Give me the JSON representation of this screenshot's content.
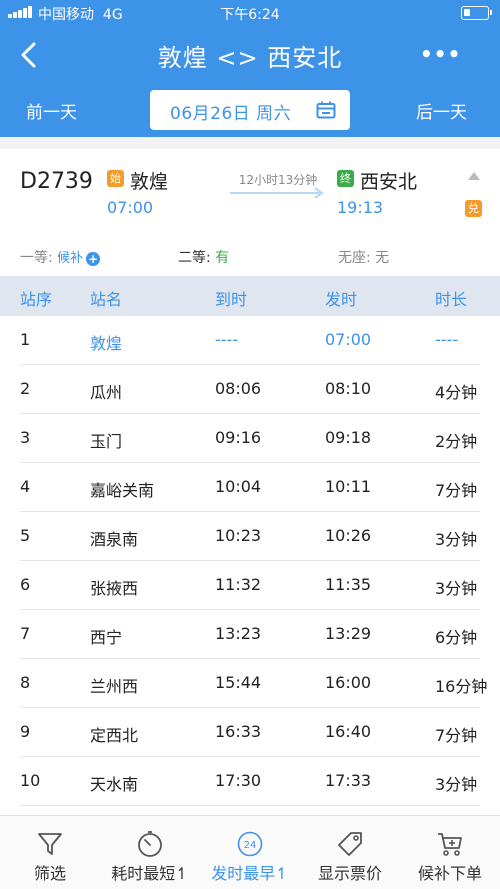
{
  "status_bar": {
    "carrier": "中国移动",
    "network": "4G",
    "time": "下午6:24",
    "battery_level": 0.25
  },
  "nav": {
    "title": "敦煌 <> 西安北",
    "back_icon": "back-arrow-icon",
    "more_label": "•••"
  },
  "date_bar": {
    "prev_label": "前一天",
    "date": "06月26日 周六",
    "next_label": "后一天",
    "calendar_icon": "calendar-icon"
  },
  "train": {
    "number": "D2739",
    "from_badge": "始",
    "from_station": "敦煌",
    "from_time": "07:00",
    "duration": "12小时13分钟",
    "to_badge": "终",
    "to_station": "西安北",
    "to_time": "19:13",
    "exchange_badge": "兑"
  },
  "seats": [
    {
      "label": "一等: ",
      "value": "候补"
    },
    {
      "label": "二等: ",
      "value": "有"
    },
    {
      "label": "无座: ",
      "value": "无"
    }
  ],
  "table": {
    "headers": [
      "站序",
      "站名",
      "到时",
      "发时",
      "时长"
    ],
    "rows": [
      [
        "1",
        "敦煌",
        "----",
        "07:00",
        "----"
      ],
      [
        "2",
        "瓜州",
        "08:06",
        "08:10",
        "4分钟"
      ],
      [
        "3",
        "玉门",
        "09:16",
        "09:18",
        "2分钟"
      ],
      [
        "4",
        "嘉峪关南",
        "10:04",
        "10:11",
        "7分钟"
      ],
      [
        "5",
        "酒泉南",
        "10:23",
        "10:26",
        "3分钟"
      ],
      [
        "6",
        "张掖西",
        "11:32",
        "11:35",
        "3分钟"
      ],
      [
        "7",
        "西宁",
        "13:23",
        "13:29",
        "6分钟"
      ],
      [
        "8",
        "兰州西",
        "15:44",
        "16:00",
        "16分钟"
      ],
      [
        "9",
        "定西北",
        "16:33",
        "16:40",
        "7分钟"
      ],
      [
        "10",
        "天水南",
        "17:30",
        "17:33",
        "3分钟"
      ]
    ]
  },
  "tabbar": {
    "items": [
      {
        "label": "筛选",
        "icon": "filter-icon"
      },
      {
        "label": "耗时最短↿",
        "icon": "timer-icon"
      },
      {
        "label": "发时最早↿",
        "icon": "clock-24-icon",
        "active": true,
        "icon_text": "24"
      },
      {
        "label": "显示票价",
        "icon": "price-tag-icon"
      },
      {
        "label": "候补下单",
        "icon": "cart-plus-icon"
      }
    ]
  },
  "colors": {
    "primary": "#3d93e8",
    "orange": "#f39c2c",
    "green": "#3cac4b"
  }
}
